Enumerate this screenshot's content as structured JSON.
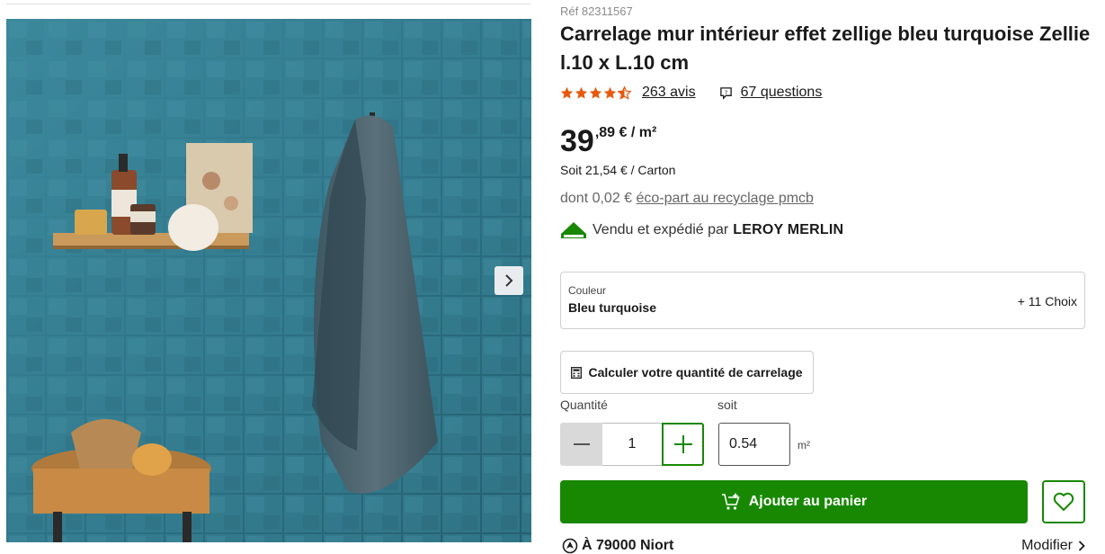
{
  "product": {
    "ref": "Réf 82311567",
    "title": "Carrelage mur intérieur effet zellige bleu turquoise Zellie l.10 x L.10 cm",
    "rating_value": 4.5,
    "rating_max": 5,
    "reviews_link": "263 avis",
    "questions_link": "67 questions"
  },
  "price": {
    "integer": "39",
    "decimal": ",89 € / m²",
    "per_carton": "Soit 21,54 € / Carton",
    "ecopart_prefix": "dont 0,02 € ",
    "ecopart_link": "éco-part au recyclage pmcb"
  },
  "seller": {
    "prefix": "Vendu et expédié par",
    "brand": "LEROY MERLIN"
  },
  "color_selector": {
    "label": "Couleur",
    "value": "Bleu turquoise",
    "more": "+ 11 Choix"
  },
  "calculator": {
    "label": "Calculer votre quantité de carrelage"
  },
  "quantity": {
    "label": "Quantité",
    "value": "1",
    "equiv_label": "soit",
    "equiv_value": "0.54",
    "equiv_unit": "m²"
  },
  "cart": {
    "add_label": "Ajouter au panier"
  },
  "store": {
    "label": "À 79000 Niort",
    "modify": "Modifier"
  },
  "colors": {
    "primary_green": "#188803",
    "star_orange": "#e8590c",
    "tile_blue": "#2f7a8f"
  },
  "icons": {
    "next": "chevron-right-icon",
    "question": "question-bubble-icon",
    "calc": "calculator-icon",
    "cart": "cart-plus-icon",
    "favorite": "heart-icon",
    "location": "location-pin-icon"
  }
}
